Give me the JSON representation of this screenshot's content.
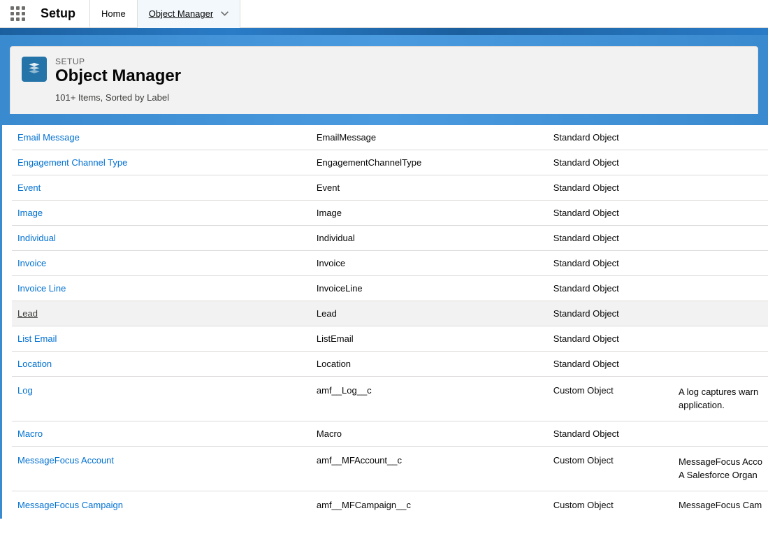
{
  "nav": {
    "title": "Setup",
    "tabs": [
      {
        "label": "Home"
      },
      {
        "label": "Object Manager"
      }
    ]
  },
  "header": {
    "breadcrumb": "SETUP",
    "title": "Object Manager",
    "subtitle": "101+ Items, Sorted by Label"
  },
  "rows": [
    {
      "label": "Email Message",
      "api": "EmailMessage",
      "type": "Standard Object",
      "desc": ""
    },
    {
      "label": "Engagement Channel Type",
      "api": "EngagementChannelType",
      "type": "Standard Object",
      "desc": ""
    },
    {
      "label": "Event",
      "api": "Event",
      "type": "Standard Object",
      "desc": ""
    },
    {
      "label": "Image",
      "api": "Image",
      "type": "Standard Object",
      "desc": ""
    },
    {
      "label": "Individual",
      "api": "Individual",
      "type": "Standard Object",
      "desc": ""
    },
    {
      "label": "Invoice",
      "api": "Invoice",
      "type": "Standard Object",
      "desc": ""
    },
    {
      "label": "Invoice Line",
      "api": "InvoiceLine",
      "type": "Standard Object",
      "desc": ""
    },
    {
      "label": "Lead",
      "api": "Lead",
      "type": "Standard Object",
      "desc": ""
    },
    {
      "label": "List Email",
      "api": "ListEmail",
      "type": "Standard Object",
      "desc": ""
    },
    {
      "label": "Location",
      "api": "Location",
      "type": "Standard Object",
      "desc": ""
    },
    {
      "label": "Log",
      "api": "amf__Log__c",
      "type": "Custom Object",
      "desc": "A log captures warn\napplication."
    },
    {
      "label": "Macro",
      "api": "Macro",
      "type": "Standard Object",
      "desc": ""
    },
    {
      "label": "MessageFocus Account",
      "api": "amf__MFAccount__c",
      "type": "Custom Object",
      "desc": "MessageFocus Acco\nA Salesforce Organ"
    },
    {
      "label": "MessageFocus Campaign",
      "api": "amf__MFCampaign__c",
      "type": "Custom Object",
      "desc": "MessageFocus Cam"
    }
  ]
}
